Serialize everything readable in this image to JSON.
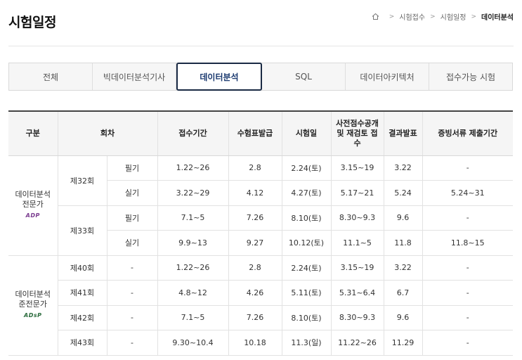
{
  "header": {
    "title": "시험일정",
    "breadcrumb": [
      "시험접수",
      "시험일정",
      "데이터분석"
    ]
  },
  "tabs": [
    {
      "label": "전체",
      "active": false
    },
    {
      "label": "빅데이터분석기사",
      "active": false
    },
    {
      "label": "데이터분석",
      "active": true
    },
    {
      "label": "SQL",
      "active": false
    },
    {
      "label": "데이터아키텍처",
      "active": false
    },
    {
      "label": "접수가능 시험",
      "active": false
    }
  ],
  "table": {
    "headers": [
      "구분",
      "회차",
      "접수기간",
      "수험표발급",
      "시험일",
      "사전점수공개 및 재검토 접수",
      "결과발표",
      "증빙서류 제출기간"
    ],
    "groups": [
      {
        "name_line1": "데이터분석",
        "name_line2": "전문가",
        "logo": "ADP",
        "rounds": [
          {
            "round": "제32회",
            "rows": [
              {
                "type": "필기",
                "cells": [
                  "1.22~26",
                  "2.8",
                  "2.24(토)",
                  "3.15~19",
                  "3.22",
                  "-"
                ]
              },
              {
                "type": "실기",
                "cells": [
                  "3.22~29",
                  "4.12",
                  "4.27(토)",
                  "5.17~21",
                  "5.24",
                  "5.24~31"
                ]
              }
            ]
          },
          {
            "round": "제33회",
            "rows": [
              {
                "type": "필기",
                "cells": [
                  "7.1~5",
                  "7.26",
                  "8.10(토)",
                  "8.30~9.3",
                  "9.6",
                  "-"
                ]
              },
              {
                "type": "실기",
                "cells": [
                  "9.9~13",
                  "9.27",
                  "10.12(토)",
                  "11.1~5",
                  "11.8",
                  "11.8~15"
                ]
              }
            ]
          }
        ]
      },
      {
        "name_line1": "데이터분석",
        "name_line2": "준전문가",
        "logo": "ADsP",
        "rows": [
          {
            "round": "제40회",
            "type": "-",
            "cells": [
              "1.22~26",
              "2.8",
              "2.24(토)",
              "3.15~19",
              "3.22",
              "-"
            ]
          },
          {
            "round": "제41회",
            "type": "-",
            "cells": [
              "4.8~12",
              "4.26",
              "5.11(토)",
              "5.31~6.4",
              "6.7",
              "-"
            ]
          },
          {
            "round": "제42회",
            "type": "-",
            "cells": [
              "7.1~5",
              "7.26",
              "8.10(토)",
              "8.30~9.3",
              "9.6",
              "-"
            ]
          },
          {
            "round": "제43회",
            "type": "-",
            "cells": [
              "9.30~10.4",
              "10.18",
              "11.3(일)",
              "11.22~26",
              "11.29",
              "-"
            ]
          }
        ]
      }
    ]
  },
  "icons": {
    "home": "home-icon",
    "separator": "chevron-right-icon"
  }
}
